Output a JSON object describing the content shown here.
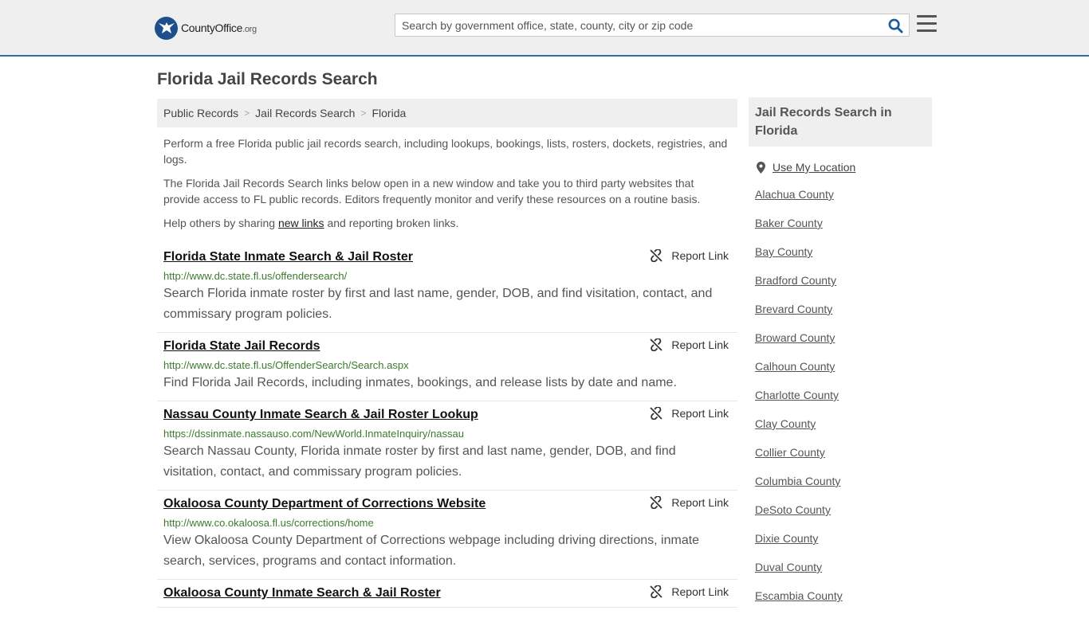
{
  "header": {
    "logo_main": "CountyOffice",
    "logo_suffix": ".org",
    "search_placeholder": "Search by government office, state, county, city or zip code"
  },
  "page_title": "Florida Jail Records Search",
  "breadcrumb": [
    "Public Records",
    "Jail Records Search",
    "Florida"
  ],
  "intro": {
    "p1": "Perform a free Florida public jail records search, including lookups, bookings, lists, rosters, dockets, registries, and logs.",
    "p2": "The Florida Jail Records Search links below open in a new window and take you to third party websites that provide access to FL public records. Editors frequently monitor and verify these resources on a routine basis.",
    "p3_before": "Help others by sharing ",
    "p3_link": "new links",
    "p3_after": " and reporting broken links."
  },
  "report_label": "Report Link",
  "results": [
    {
      "title": "Florida State Inmate Search & Jail Roster",
      "url": "http://www.dc.state.fl.us/offendersearch/",
      "desc": "Search Florida inmate roster by first and last name, gender, DOB, and find visitation, contact, and commissary program policies."
    },
    {
      "title": "Florida State Jail Records",
      "url": "http://www.dc.state.fl.us/OffenderSearch/Search.aspx",
      "desc": "Find Florida Jail Records, including inmates, bookings, and release lists by date and name."
    },
    {
      "title": "Nassau County Inmate Search & Jail Roster Lookup",
      "url": "https://dssinmate.nassauso.com/NewWorld.InmateInquiry/nassau",
      "desc": "Search Nassau County, Florida inmate roster by first and last name, gender, DOB, and find visitation, contact, and commissary program policies."
    },
    {
      "title": "Okaloosa County Department of Corrections Website",
      "url": "http://www.co.okaloosa.fl.us/corrections/home",
      "desc": "View Okaloosa County Department of Corrections webpage including driving directions, inmate search, services, programs and contact information."
    },
    {
      "title": "Okaloosa County Inmate Search & Jail Roster",
      "url": "",
      "desc": ""
    }
  ],
  "sidebar": {
    "heading": "Jail Records Search in Florida",
    "use_location": "Use My Location",
    "counties": [
      "Alachua County",
      "Baker County",
      "Bay County",
      "Bradford County",
      "Brevard County",
      "Broward County",
      "Calhoun County",
      "Charlotte County",
      "Clay County",
      "Collier County",
      "Columbia County",
      "DeSoto County",
      "Dixie County",
      "Duval County",
      "Escambia County"
    ]
  },
  "colors": {
    "accent": "#2f6bb0",
    "logo_blue": "#1d4f8c",
    "url_green": "#3d7a2e",
    "panel_gray": "#efefef"
  }
}
